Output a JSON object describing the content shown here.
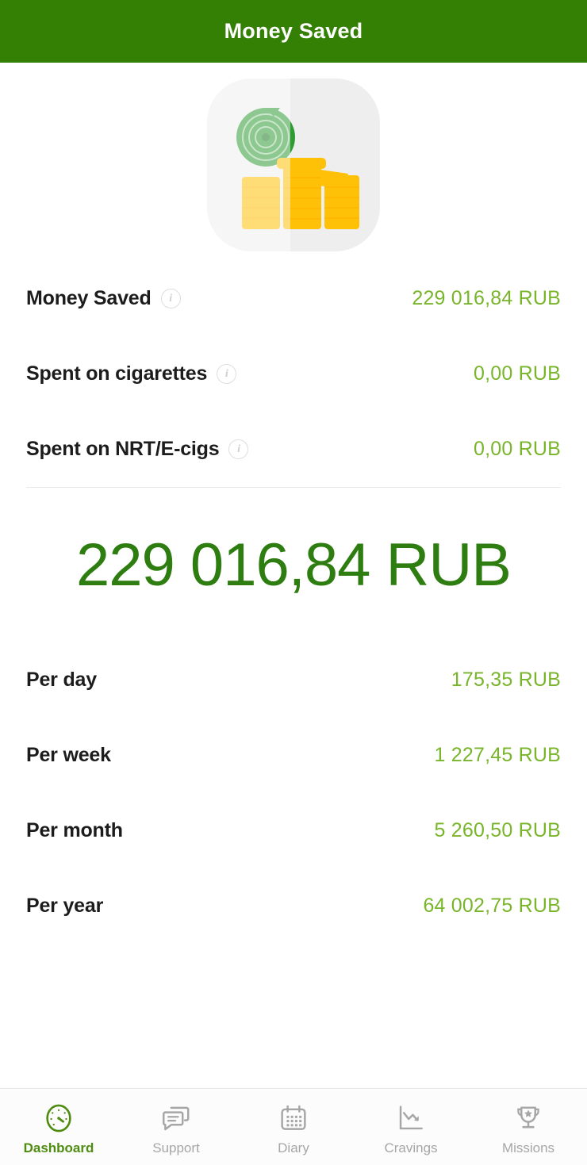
{
  "header": {
    "title": "Money Saved",
    "background_color": "#348005",
    "text_color": "#ffffff"
  },
  "hero": {
    "illustration_name": "money-saved-coins-illustration",
    "card_color": "#eeeeee",
    "coin_color": "#FFC107",
    "coin_shadow_color": "#FFB300",
    "target_color": "#2e9b34"
  },
  "colors": {
    "value_green": "#79b52b",
    "total_green": "#2e7d10",
    "label_dark": "#1c1c1c",
    "muted_gray": "#a6a6a6",
    "active_green": "#4e8c10"
  },
  "stats": [
    {
      "label": "Money Saved",
      "value": "229 016,84 RUB",
      "has_info": true
    },
    {
      "label": "Spent on cigarettes",
      "value": "0,00 RUB",
      "has_info": true
    },
    {
      "label": "Spent on NRT/E-cigs",
      "value": "0,00 RUB",
      "has_info": true
    }
  ],
  "total": {
    "value": "229 016,84 RUB"
  },
  "breakdown": [
    {
      "label": "Per day",
      "value": "175,35 RUB"
    },
    {
      "label": "Per week",
      "value": "1 227,45 RUB"
    },
    {
      "label": "Per month",
      "value": "5 260,50 RUB"
    },
    {
      "label": "Per year",
      "value": "64 002,75 RUB"
    }
  ],
  "tabs": [
    {
      "label": "Dashboard",
      "icon": "gauge-icon",
      "active": true
    },
    {
      "label": "Support",
      "icon": "chat-bubbles-icon",
      "active": false
    },
    {
      "label": "Diary",
      "icon": "calendar-icon",
      "active": false
    },
    {
      "label": "Cravings",
      "icon": "line-chart-icon",
      "active": false
    },
    {
      "label": "Missions",
      "icon": "trophy-icon",
      "active": false
    }
  ]
}
